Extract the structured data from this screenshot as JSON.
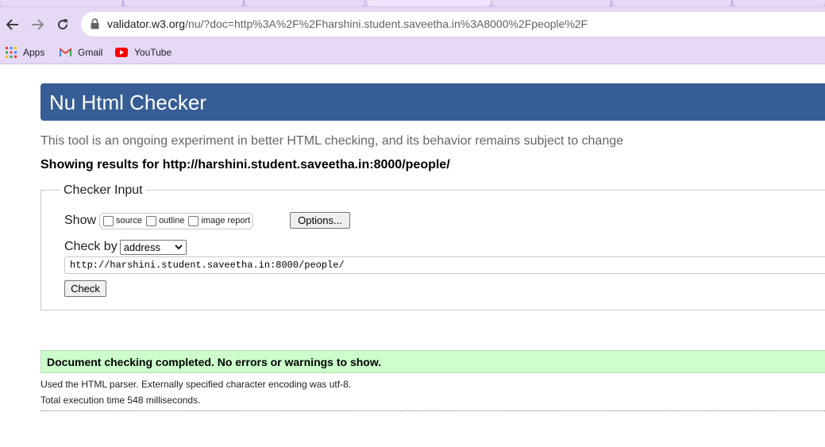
{
  "browser": {
    "url_host": "validator.w3.org",
    "url_rest": "/nu/?doc=http%3A%2F%2Fharshini.student.saveetha.in%3A8000%2Fpeople%2F",
    "bookmarks": [
      {
        "label": "Apps",
        "icon": "apps-grid-icon"
      },
      {
        "label": "Gmail",
        "icon": "gmail-icon"
      },
      {
        "label": "YouTube",
        "icon": "youtube-icon"
      }
    ],
    "colors": {
      "chrome": "#e6d9f5",
      "tabstrip": "#d7c3ee"
    }
  },
  "page": {
    "title": "Nu Html Checker",
    "intro": "This tool is an ongoing experiment in better HTML checking, and its behavior remains subject to change",
    "showing_prefix": "Showing results for ",
    "showing_url": "http://harshini.student.saveetha.in:8000/people/",
    "checker_input": {
      "legend": "Checker Input",
      "show_label": "Show",
      "options": [
        {
          "label": "source",
          "checked": false
        },
        {
          "label": "outline",
          "checked": false
        },
        {
          "label": "image report",
          "checked": false
        }
      ],
      "options_button": "Options...",
      "check_by_label": "Check by",
      "check_by_value": "address",
      "doc_value": "http://harshini.student.saveetha.in:8000/people/",
      "check_button": "Check"
    },
    "result": {
      "success_message": "Document checking completed. No errors or warnings to show.",
      "parser_info": "Used the HTML parser. Externally specified character encoding was utf-8.",
      "execution_time": "Total execution time 548 milliseconds."
    },
    "colors": {
      "banner": "#365d95",
      "success_bg": "#ccffcc"
    }
  }
}
